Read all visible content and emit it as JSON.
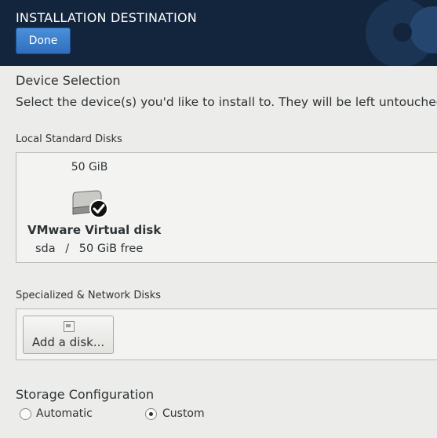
{
  "header": {
    "title": "INSTALLATION DESTINATION",
    "done_label": "Done"
  },
  "device_selection": {
    "title": "Device Selection",
    "description": "Select the device(s) you'd like to install to.  They will be left untouched"
  },
  "local_disks": {
    "title": "Local Standard Disks",
    "disks": [
      {
        "size": "50 GiB",
        "name": "VMware Virtual disk",
        "device": "sda",
        "separator": "/",
        "free": "50 GiB free",
        "selected": true
      }
    ]
  },
  "network_disks": {
    "title": "Specialized & Network Disks",
    "add_label": "Add a disk..."
  },
  "storage": {
    "title": "Storage Configuration",
    "options": [
      {
        "label": "Automatic",
        "checked": false
      },
      {
        "label": "Custom",
        "checked": true
      }
    ]
  }
}
